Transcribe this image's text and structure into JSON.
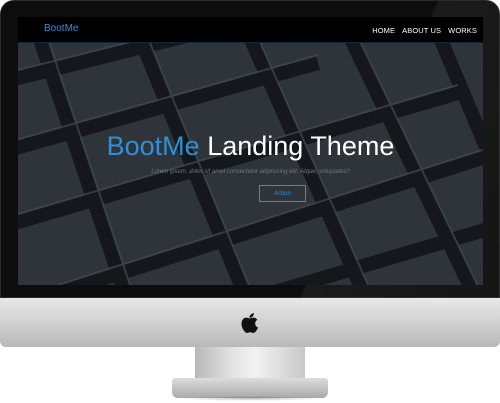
{
  "navbar": {
    "brand": "BootMe",
    "links": [
      "HOME",
      "ABOUT US",
      "WORKS"
    ]
  },
  "hero": {
    "title_accent": "BootMe",
    "title_rest": " Landing Theme",
    "subtitle": "Lorem ipsum, dolor sit amet consectetur adipisicing elit. Atque, voluptates?",
    "button_label": "Action"
  },
  "colors": {
    "accent": "#2f8fd8",
    "navbar_bg": "#000000",
    "hero_bg": "#32363d"
  },
  "icons": {
    "monitor_logo": "apple-icon"
  }
}
